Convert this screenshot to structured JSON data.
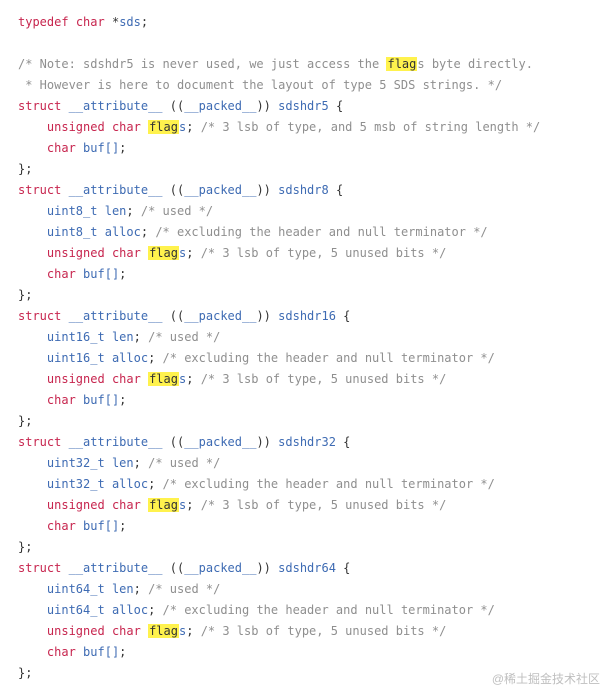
{
  "typedef_line": {
    "kw1": "typedef",
    "kw2": "char",
    "star": "*",
    "name": "sds",
    "semi": ";"
  },
  "note_comment": {
    "l1a": "/* Note: sdshdr5 is never used, we just access the ",
    "l1_hl": "flag",
    "l1b": "s byte directly.",
    "l2": " * However is here to document the layout of type 5 SDS strings. */"
  },
  "struct_head": {
    "kw_struct": "struct",
    "attr_full": "__attribute__",
    "packed": "__packed__",
    "open": "((",
    "close": "))",
    "brace_open": "{",
    "brace_close": "};"
  },
  "names": {
    "s5": "sdshdr5",
    "s8": "sdshdr8",
    "s16": "sdshdr16",
    "s32": "sdshdr32",
    "s64": "sdshdr64"
  },
  "flags_line": {
    "kw_unsigned": "unsigned",
    "kw_char": "char",
    "hl": "flag",
    "rest_s": "s",
    "semi": ";",
    "cmt5": "/* 3 lsb of type, and 5 msb of string length */",
    "cmt_u": "/* 3 lsb of type, 5 unused bits */"
  },
  "buf_line": {
    "kw_char": "char",
    "name": "buf[]",
    "semi": ";"
  },
  "fields": {
    "u8": "uint8_t",
    "u16": "uint16_t",
    "u32": "uint32_t",
    "u64": "uint64_t",
    "len": "len",
    "alloc": "alloc",
    "semi": ";",
    "cmt_used": "/* used */",
    "cmt_alloc": "/* excluding the header and null terminator */"
  },
  "watermark": "@稀土掘金技术社区"
}
